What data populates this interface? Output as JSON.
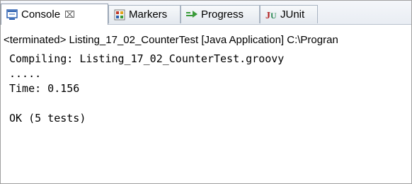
{
  "tabs": [
    {
      "label": "Console",
      "icon": "console-icon",
      "active": true,
      "close": "⌧"
    },
    {
      "label": "Markers",
      "icon": "markers-icon",
      "active": false
    },
    {
      "label": "Progress",
      "icon": "progress-icon",
      "active": false
    },
    {
      "label": "JUnit",
      "icon": "junit-icon",
      "active": false
    }
  ],
  "description": "<terminated> Listing_17_02_CounterTest [Java Application] C:\\Progran",
  "output": {
    "lines": [
      "Compiling: Listing_17_02_CounterTest.groovy",
      ".....",
      "Time: 0.156",
      "",
      "OK (5 tests)"
    ]
  },
  "colors": {
    "console_icon": "#2a5fb0",
    "markers_icon": "#c0392b",
    "progress_icon": "#3a9b3a",
    "junit_icon": "#b22222"
  }
}
